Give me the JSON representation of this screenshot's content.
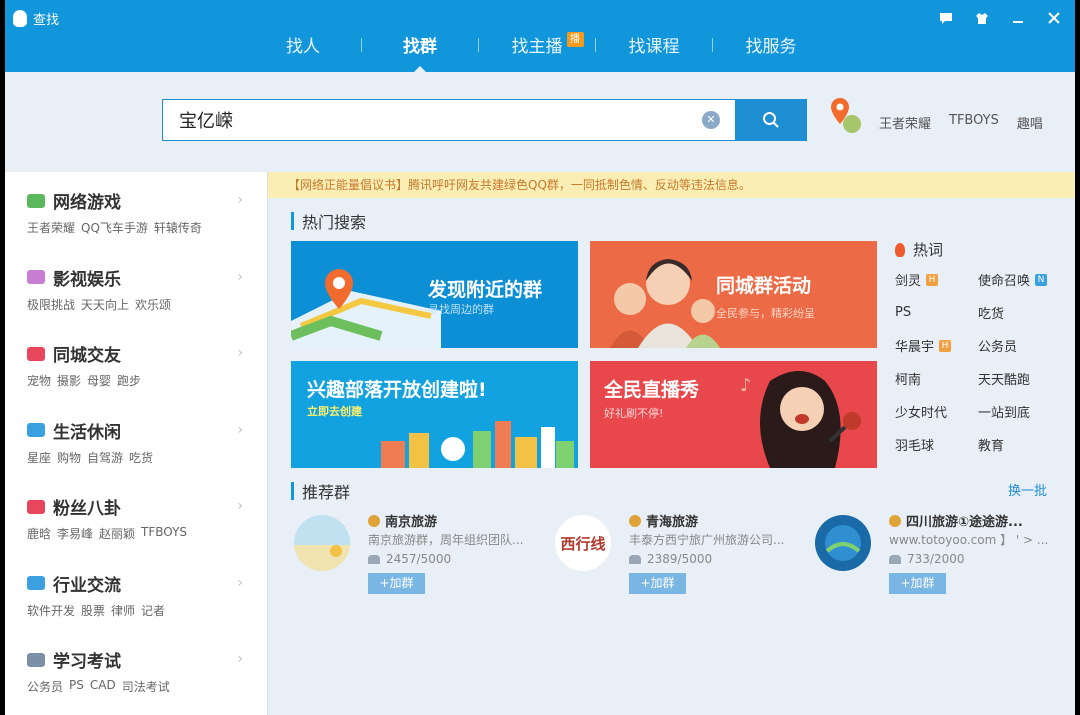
{
  "app": {
    "title": "查找"
  },
  "nav": {
    "items": [
      {
        "label": "找人",
        "active": false
      },
      {
        "label": "找群",
        "active": true
      },
      {
        "label": "找主播",
        "active": false,
        "badge": "播"
      },
      {
        "label": "找课程",
        "active": false
      },
      {
        "label": "找服务",
        "active": false
      }
    ]
  },
  "search": {
    "value": "宝亿嵘"
  },
  "quick_links": [
    "王者荣耀",
    "TFBOYS",
    "趣唱"
  ],
  "sidebar": {
    "categories": [
      {
        "title": "网络游戏",
        "color": "#5cb85c",
        "tags": [
          "王者荣耀",
          "QQ飞车手游",
          "轩辕传奇"
        ]
      },
      {
        "title": "影视娱乐",
        "color": "#c97fd1",
        "tags": [
          "极限挑战",
          "天天向上",
          "欢乐颂"
        ]
      },
      {
        "title": "同城交友",
        "color": "#e8465d",
        "tags": [
          "宠物",
          "摄影",
          "母婴",
          "跑步"
        ]
      },
      {
        "title": "生活休闲",
        "color": "#3aa0e0",
        "tags": [
          "星座",
          "购物",
          "自驾游",
          "吃货"
        ]
      },
      {
        "title": "粉丝八卦",
        "color": "#e8465d",
        "tags": [
          "鹿晗",
          "李易峰",
          "赵丽颖",
          "TFBOYS"
        ]
      },
      {
        "title": "行业交流",
        "color": "#3aa0e0",
        "tags": [
          "软件开发",
          "股票",
          "律师",
          "记者"
        ]
      },
      {
        "title": "学习考试",
        "color": "#7b8fa6",
        "tags": [
          "公务员",
          "PS",
          "CAD",
          "司法考试"
        ]
      }
    ]
  },
  "notice": "【网络正能量倡议书】腾讯呼吁网友共建绿色QQ群，一同抵制色情、反动等违法信息。",
  "hot_search": {
    "title": "热门搜索",
    "banners": [
      {
        "title": "发现附近的群",
        "subtitle": "寻找周边的群"
      },
      {
        "title": "同城群活动",
        "subtitle": "全民参与，精彩纷呈"
      },
      {
        "title": "兴趣部落开放创建啦!",
        "subtitle": "立即去创建"
      },
      {
        "title": "全民直播秀",
        "subtitle": "好礼刷不停!"
      }
    ],
    "hot_words_title": "热词",
    "hot_words": [
      {
        "label": "剑灵",
        "badge": "H",
        "badge_color": "#f0a040"
      },
      {
        "label": "使命召唤",
        "badge": "N",
        "badge_color": "#3aa0e0"
      },
      {
        "label": "PS"
      },
      {
        "label": "吃货"
      },
      {
        "label": "华晨宇",
        "badge": "H",
        "badge_color": "#f0a040"
      },
      {
        "label": "公务员"
      },
      {
        "label": "柯南"
      },
      {
        "label": "天天酷跑"
      },
      {
        "label": "少女时代"
      },
      {
        "label": "一站到底"
      },
      {
        "label": "羽毛球"
      },
      {
        "label": "教育"
      }
    ]
  },
  "recommended": {
    "title": "推荐群",
    "refresh_label": "换一批",
    "join_label": "+加群",
    "groups": [
      {
        "name": "南京旅游",
        "desc": "南京旅游群，周年组织团队...",
        "count": "2457/5000",
        "avatar_text": ""
      },
      {
        "name": "青海旅游",
        "desc": "丰泰方西宁旅广州旅游公司...",
        "count": "2389/5000",
        "avatar_text": "西行线"
      },
      {
        "name": "四川旅游①途途游...",
        "desc": "www.totoyoo.com 】 ' > ...",
        "count": "733/2000",
        "avatar_text": ""
      }
    ]
  },
  "colors": {
    "brand": "#1296db",
    "search_button": "#1d8ed2"
  }
}
